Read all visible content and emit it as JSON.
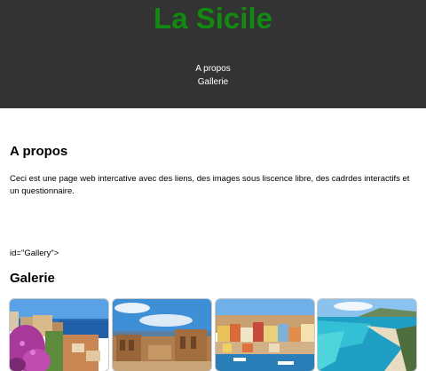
{
  "header": {
    "title": "La Sicile",
    "nav": [
      {
        "label": "A propos"
      },
      {
        "label": "Gallerie"
      }
    ]
  },
  "about": {
    "heading": "A propos",
    "text": "Ceci est une page web intercative avec des liens, des images sous liscence libre, des cadrdes interactifs et un questionnaire."
  },
  "stray_text": "id=\"Gallery\">",
  "gallery": {
    "heading": "Galerie",
    "images": [
      {
        "icon": "coastal-village-flowers-photo"
      },
      {
        "icon": "greek-theatre-ruins-photo"
      },
      {
        "icon": "colorful-harbor-town-photo"
      },
      {
        "icon": "turquoise-beach-bay-photo"
      }
    ]
  },
  "colors": {
    "header_bg": "#333333",
    "title": "#128a12",
    "nav_text": "#ffffff"
  }
}
